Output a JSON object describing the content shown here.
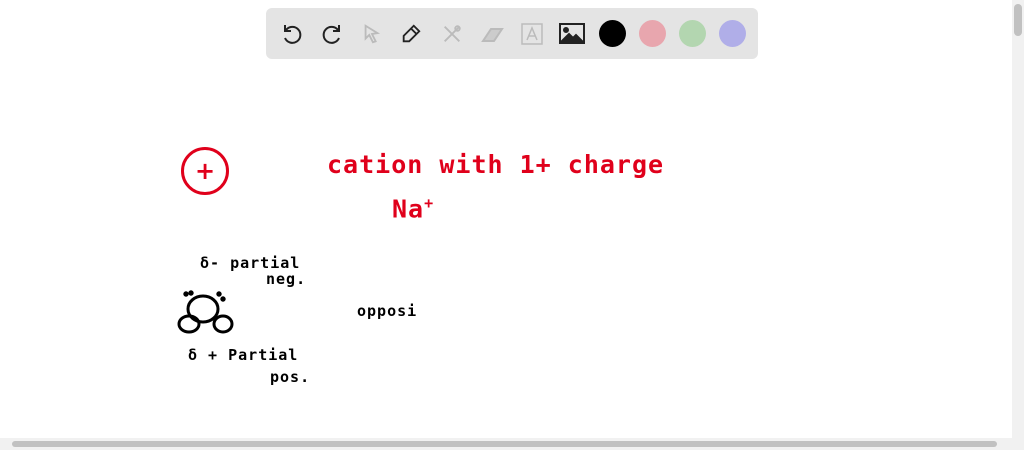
{
  "toolbar": {
    "tools": [
      "undo-icon",
      "redo-icon",
      "select-icon",
      "pen-icon",
      "tools-icon",
      "eraser-icon",
      "text-icon",
      "image-icon"
    ],
    "colors": [
      "#000000",
      "#e8a6ae",
      "#b3d6b0",
      "#b0aee8"
    ]
  },
  "canvas": {
    "circle_symbol": "+",
    "title": "cation with 1+ charge",
    "ion": "Na",
    "ion_charge": "+",
    "delta_neg": "δ- partial",
    "delta_neg_2": "neg.",
    "delta_pos": "δ + Partial",
    "delta_pos_2": "pos.",
    "opposite": "opposi"
  },
  "colors": {
    "ink_red": "#e0001b",
    "ink_black": "#000000"
  }
}
